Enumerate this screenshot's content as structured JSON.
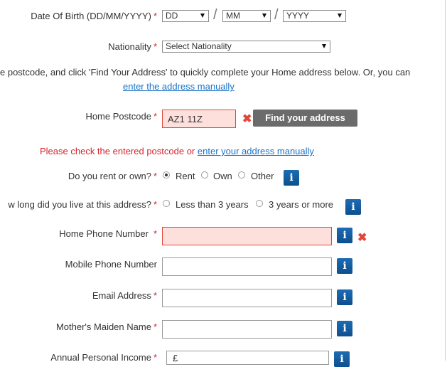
{
  "dob": {
    "label": "Date Of Birth (DD/MM/YYYY)",
    "req": "*",
    "day": "DD",
    "month": "MM",
    "year": "YYYY",
    "sep": "/"
  },
  "nationality": {
    "label": "Nationality",
    "req": "*",
    "value": "Select Nationality"
  },
  "postcode_help": {
    "text": "e postcode, and click 'Find Your Address' to quickly complete your Home address below. Or, you can",
    "link": "enter the address manually"
  },
  "home_postcode": {
    "label": "Home Postcode",
    "req": "*",
    "value": "AZ1 11Z",
    "button": "Find your address",
    "error_icon": "close-icon"
  },
  "postcode_error": {
    "text": "Please check the entered postcode or",
    "link": "enter your address manually"
  },
  "rent_own": {
    "label": "Do you rent or own?",
    "req": "*",
    "options": [
      "Rent",
      "Own",
      "Other"
    ],
    "selected": "Rent"
  },
  "time_at_address": {
    "label": "w long did you live at this address?",
    "req": "*",
    "options": [
      "Less than 3 years",
      "3 years or more"
    ],
    "selected": ""
  },
  "home_phone": {
    "label": "Home Phone Number",
    "req": "*",
    "value": ""
  },
  "mobile_phone": {
    "label": "Mobile Phone Number",
    "value": ""
  },
  "email": {
    "label": "Email Address",
    "req": "*",
    "value": ""
  },
  "maiden_name": {
    "label": "Mother's Maiden Name",
    "req": "*",
    "value": ""
  },
  "income": {
    "label": "Annual Personal Income",
    "req": "*",
    "value": "£"
  },
  "info_glyph": "i",
  "colors": {
    "error": "#d9232d",
    "link": "#1a73c9",
    "info": "#1d6cb3",
    "button": "#6b6b6b"
  }
}
